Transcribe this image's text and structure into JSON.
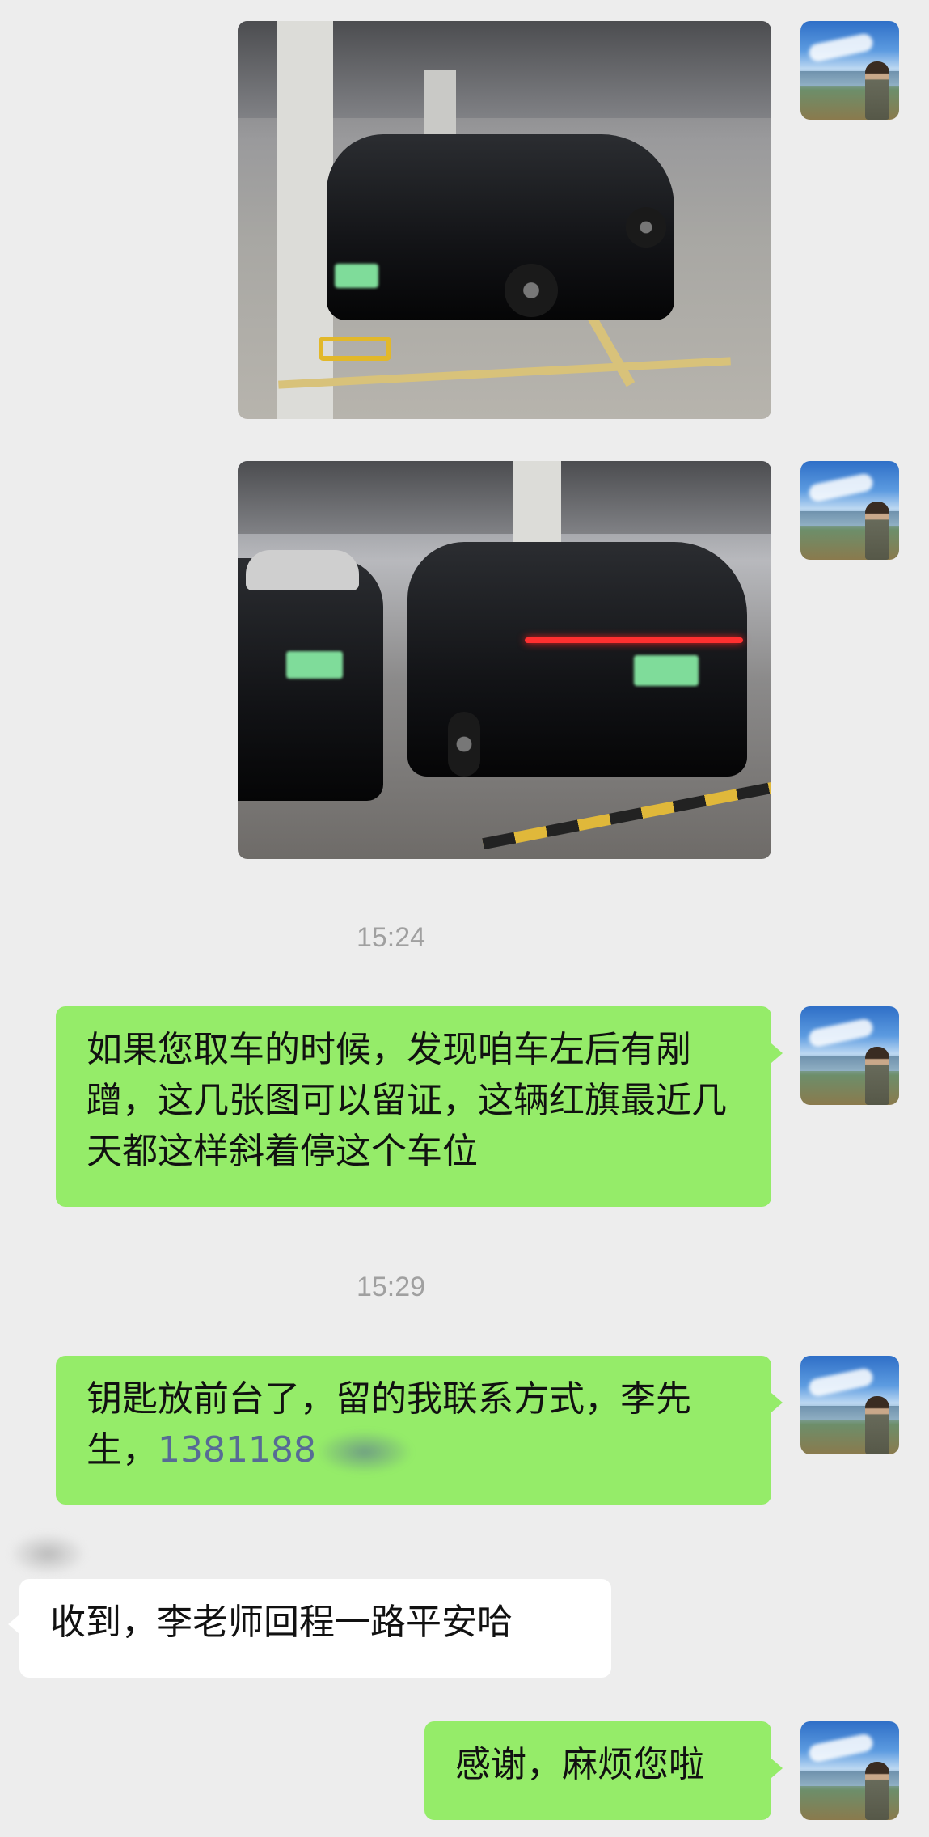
{
  "messages": {
    "timestamp_1": "15:24",
    "msg_1": "如果您取车的时候，发现咱车左后有剐蹭，这几张图可以留证，这辆红旗最近几天都这样斜着停这个车位",
    "timestamp_2": "15:29",
    "msg_2_text": "钥匙放前台了，留的我联系方式，李先生，",
    "msg_2_phone": "1381188",
    "msg_3": "收到，李老师回程一路平安哈",
    "msg_4": "感谢，麻烦您啦"
  },
  "colors": {
    "background": "#ededed",
    "my_bubble": "#95ec69",
    "other_bubble": "#ffffff",
    "timestamp": "#a0a0a0",
    "link": "#576b95"
  },
  "icons": {
    "avatar": "landscape-avatar-icon"
  }
}
